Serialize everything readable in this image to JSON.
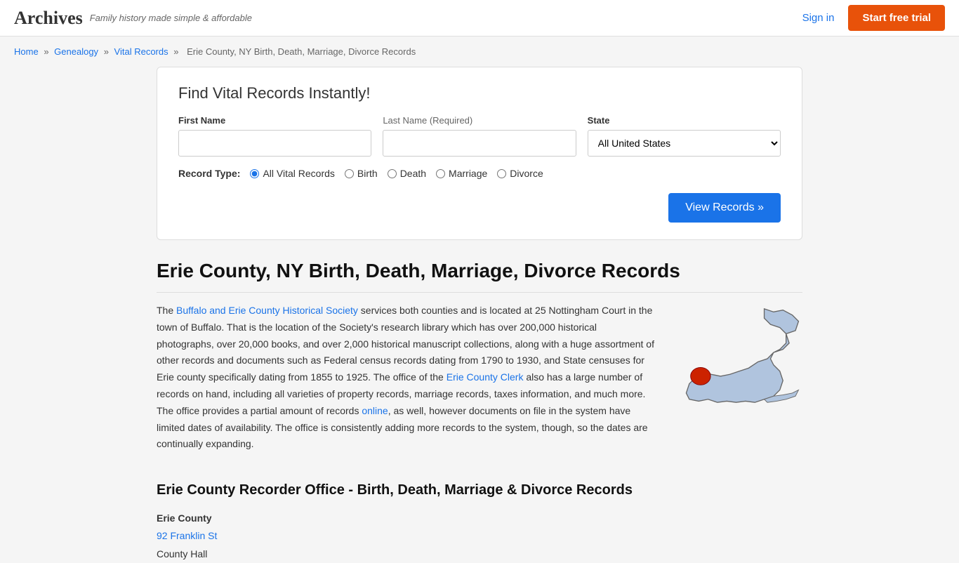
{
  "header": {
    "logo": "Archives",
    "tagline": "Family history made simple & affordable",
    "sign_in_label": "Sign in",
    "start_trial_label": "Start free trial"
  },
  "breadcrumb": {
    "home": "Home",
    "genealogy": "Genealogy",
    "vital_records": "Vital Records",
    "current_page": "Erie County, NY Birth, Death, Marriage, Divorce Records"
  },
  "search": {
    "title": "Find Vital Records Instantly!",
    "first_name_label": "First Name",
    "last_name_label": "Last Name",
    "last_name_required": "(Required)",
    "state_label": "State",
    "state_default": "All United States",
    "record_type_label": "Record Type:",
    "record_types": [
      {
        "id": "all",
        "label": "All Vital Records",
        "checked": true
      },
      {
        "id": "birth",
        "label": "Birth",
        "checked": false
      },
      {
        "id": "death",
        "label": "Death",
        "checked": false
      },
      {
        "id": "marriage",
        "label": "Marriage",
        "checked": false
      },
      {
        "id": "divorce",
        "label": "Divorce",
        "checked": false
      }
    ],
    "view_records_label": "View Records »"
  },
  "page": {
    "title": "Erie County, NY Birth, Death, Marriage, Divorce Records",
    "body_text": "The Buffalo and Erie County Historical Society services both counties and is located at 25 Nottingham Court in the town of Buffalo. That is the location of the Society's research library which has over 200,000 historical photographs, over 20,000 books, and over 2,000 historical manuscript collections, along with a huge assortment of other records and documents such as Federal census records dating from 1790 to 1930, and State censuses for Erie county specifically dating from 1855 to 1925. The office of the Erie County Clerk also has a large number of records on hand, including all varieties of property records, marriage records, taxes information, and much more. The office provides a partial amount of records online, as well, however documents on file in the system have limited dates of availability. The office is consistently adding more records to the system, though, so the dates are continually expanding.",
    "link_buffalo": "Buffalo and Erie County Historical Society",
    "link_erie_clerk": "Erie County Clerk",
    "link_online": "online",
    "section_heading": "Erie County Recorder Office - Birth, Death, Marriage & Divorce Records",
    "address_name": "Erie County",
    "address_line1": "92 Franklin St",
    "address_line2": "County Hall"
  }
}
